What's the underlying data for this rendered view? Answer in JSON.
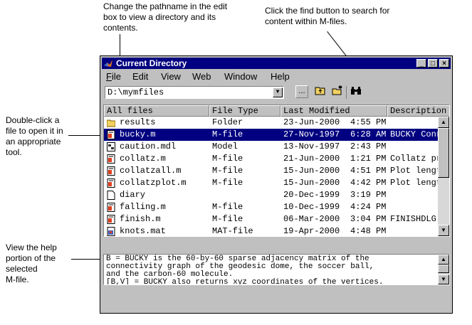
{
  "callouts": {
    "pathname": "Change the pathname in the edit\nbox to view a directory and its\ncontents.",
    "find": "Click the find button to search for\ncontent within M-files.",
    "doubleclick": "Double-click a\nfile to open it in\nan appropriate\ntool.",
    "help": "View the help\nportion of the\nselected\nM-file."
  },
  "window": {
    "title": "Current Directory",
    "title_icon": "matlab-logo-icon",
    "controls": [
      "minimize",
      "maximize",
      "close"
    ]
  },
  "menu": {
    "file": "File",
    "edit": "Edit",
    "view": "View",
    "web": "Web",
    "window": "Window",
    "help": "Help"
  },
  "toolbar": {
    "path_value": "D:\\mymfiles",
    "browse_label": "...",
    "icons": [
      "dropdown-arrow-icon",
      "up-folder-icon",
      "new-folder-icon",
      "find-binoculars-icon"
    ]
  },
  "table": {
    "headers": [
      "All files",
      "File Type",
      "Last Modified",
      "Description"
    ],
    "rows": [
      {
        "icon": "folder-icon",
        "name": "results",
        "type": "Folder",
        "date": "23-Jun-2000",
        "time": "4:55 PM",
        "desc": ""
      },
      {
        "icon": "mfile-icon",
        "name": "bucky.m",
        "type": "M-file",
        "date": "27-Nov-1997",
        "time": "6:28 AM",
        "desc": "BUCKY  Conr"
      },
      {
        "icon": "model-icon",
        "name": "caution.mdl",
        "type": "Model",
        "date": "13-Nov-1997",
        "time": "2:43 PM",
        "desc": ""
      },
      {
        "icon": "mfile-icon",
        "name": "collatz.m",
        "type": "M-file",
        "date": "21-Jun-2000",
        "time": "1:21 PM",
        "desc": "Collatz pro"
      },
      {
        "icon": "mfile-icon",
        "name": "collatzall.m",
        "type": "M-file",
        "date": "15-Jun-2000",
        "time": "4:51 PM",
        "desc": "Plot length"
      },
      {
        "icon": "mfile-icon",
        "name": "collatzplot.m",
        "type": "M-file",
        "date": "15-Jun-2000",
        "time": "4:42 PM",
        "desc": "Plot length"
      },
      {
        "icon": "document-icon",
        "name": "diary",
        "type": "",
        "date": "20-Dec-1999",
        "time": "3:19 PM",
        "desc": ""
      },
      {
        "icon": "mfile-icon",
        "name": "falling.m",
        "type": "M-file",
        "date": "10-Dec-1999",
        "time": "4:24 PM",
        "desc": ""
      },
      {
        "icon": "mfile-icon",
        "name": "finish.m",
        "type": "M-file",
        "date": "06-Mar-2000",
        "time": "3:04 PM",
        "desc": "FINISHDLG"
      },
      {
        "icon": "mat-icon",
        "name": "knots.mat",
        "type": "MAT-file",
        "date": "19-Apr-2000",
        "time": "4:48 PM",
        "desc": ""
      }
    ],
    "selected_index": 1
  },
  "helpview": {
    "text": "B = BUCKY is the 60-by-60 sparse adjacency matrix of the\nconnectivity graph of the geodesic dome, the soccer ball,\nand the carbon-60 molecule.\n[B,V] = BUCKY also returns xyz coordinates of the vertices."
  },
  "colors": {
    "titlebar": "#000080",
    "selection": "#000080",
    "chrome": "#c0c0c0"
  }
}
